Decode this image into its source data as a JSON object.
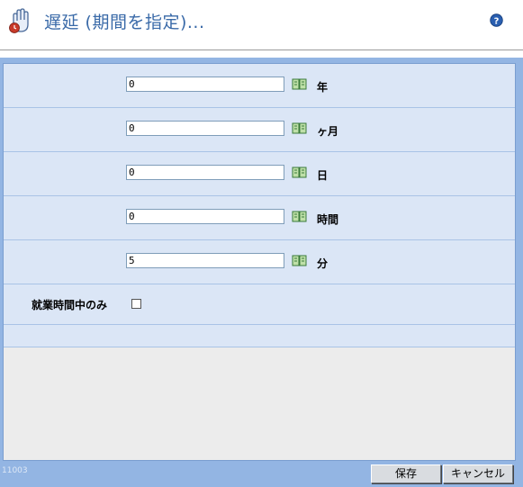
{
  "header": {
    "title": "遅延 (期間を指定)...",
    "left_icon": "hand-clock-icon",
    "help_icon": "help-icon"
  },
  "fields": [
    {
      "value": "0",
      "unit": "年"
    },
    {
      "value": "0",
      "unit": "ヶ月"
    },
    {
      "value": "0",
      "unit": "日"
    },
    {
      "value": "0",
      "unit": "時間"
    },
    {
      "value": "5",
      "unit": "分"
    }
  ],
  "work_time_only": {
    "label": "就業時間中のみ",
    "checked": false
  },
  "footer": {
    "id_text": "11003",
    "save_label": "保存",
    "cancel_label": "キャンセル"
  },
  "colors": {
    "title": "#3a6aa8",
    "panel_bg": "#dbe6f6",
    "frame_bg": "#93b5e3"
  }
}
